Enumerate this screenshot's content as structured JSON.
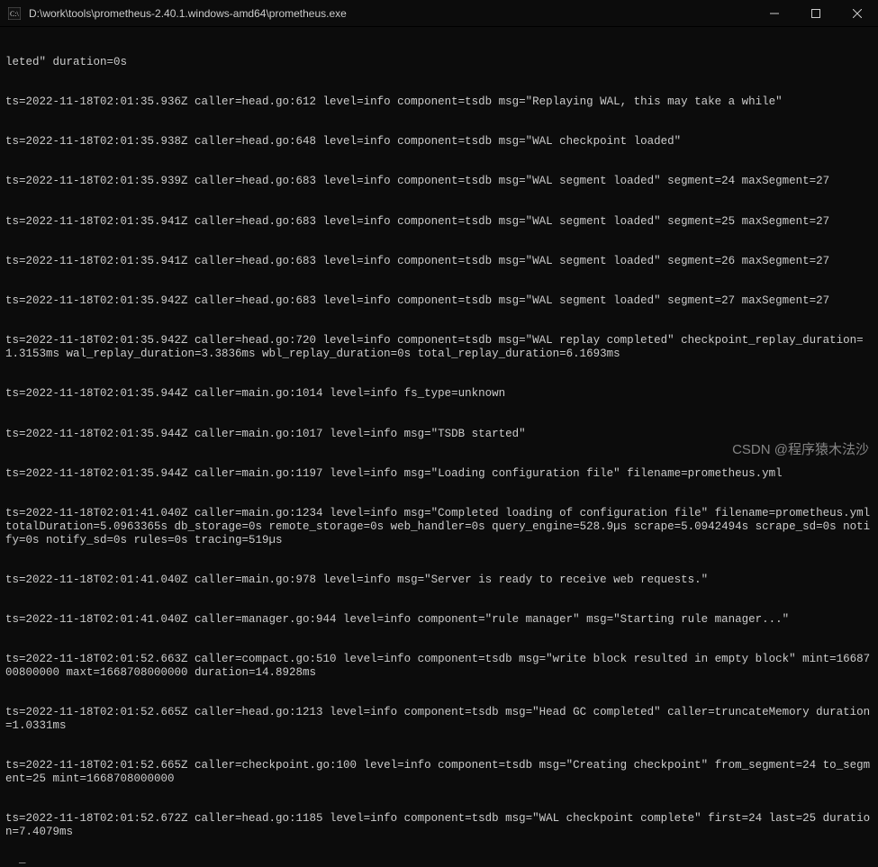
{
  "window": {
    "title": "D:\\work\\tools\\prometheus-2.40.1.windows-amd64\\prometheus.exe"
  },
  "terminal": {
    "lines": [
      "leted\" duration=0s",
      "ts=2022-11-18T02:01:35.936Z caller=head.go:612 level=info component=tsdb msg=\"Replaying WAL, this may take a while\"",
      "ts=2022-11-18T02:01:35.938Z caller=head.go:648 level=info component=tsdb msg=\"WAL checkpoint loaded\"",
      "ts=2022-11-18T02:01:35.939Z caller=head.go:683 level=info component=tsdb msg=\"WAL segment loaded\" segment=24 maxSegment=27",
      "ts=2022-11-18T02:01:35.941Z caller=head.go:683 level=info component=tsdb msg=\"WAL segment loaded\" segment=25 maxSegment=27",
      "ts=2022-11-18T02:01:35.941Z caller=head.go:683 level=info component=tsdb msg=\"WAL segment loaded\" segment=26 maxSegment=27",
      "ts=2022-11-18T02:01:35.942Z caller=head.go:683 level=info component=tsdb msg=\"WAL segment loaded\" segment=27 maxSegment=27",
      "ts=2022-11-18T02:01:35.942Z caller=head.go:720 level=info component=tsdb msg=\"WAL replay completed\" checkpoint_replay_duration=1.3153ms wal_replay_duration=3.3836ms wbl_replay_duration=0s total_replay_duration=6.1693ms",
      "ts=2022-11-18T02:01:35.944Z caller=main.go:1014 level=info fs_type=unknown",
      "ts=2022-11-18T02:01:35.944Z caller=main.go:1017 level=info msg=\"TSDB started\"",
      "ts=2022-11-18T02:01:35.944Z caller=main.go:1197 level=info msg=\"Loading configuration file\" filename=prometheus.yml",
      "ts=2022-11-18T02:01:41.040Z caller=main.go:1234 level=info msg=\"Completed loading of configuration file\" filename=prometheus.yml totalDuration=5.0963365s db_storage=0s remote_storage=0s web_handler=0s query_engine=528.9µs scrape=5.0942494s scrape_sd=0s notify=0s notify_sd=0s rules=0s tracing=519µs",
      "ts=2022-11-18T02:01:41.040Z caller=main.go:978 level=info msg=\"Server is ready to receive web requests.\"",
      "ts=2022-11-18T02:01:41.040Z caller=manager.go:944 level=info component=\"rule manager\" msg=\"Starting rule manager...\"",
      "ts=2022-11-18T02:01:52.663Z caller=compact.go:510 level=info component=tsdb msg=\"write block resulted in empty block\" mint=1668700800000 maxt=1668708000000 duration=14.8928ms",
      "ts=2022-11-18T02:01:52.665Z caller=head.go:1213 level=info component=tsdb msg=\"Head GC completed\" caller=truncateMemory duration=1.0331ms",
      "ts=2022-11-18T02:01:52.665Z caller=checkpoint.go:100 level=info component=tsdb msg=\"Creating checkpoint\" from_segment=24 to_segment=25 mint=1668708000000",
      "ts=2022-11-18T02:01:52.672Z caller=head.go:1185 level=info component=tsdb msg=\"WAL checkpoint complete\" first=24 last=25 duration=7.4079ms"
    ]
  },
  "watermark": "CSDN @程序猿木法沙"
}
